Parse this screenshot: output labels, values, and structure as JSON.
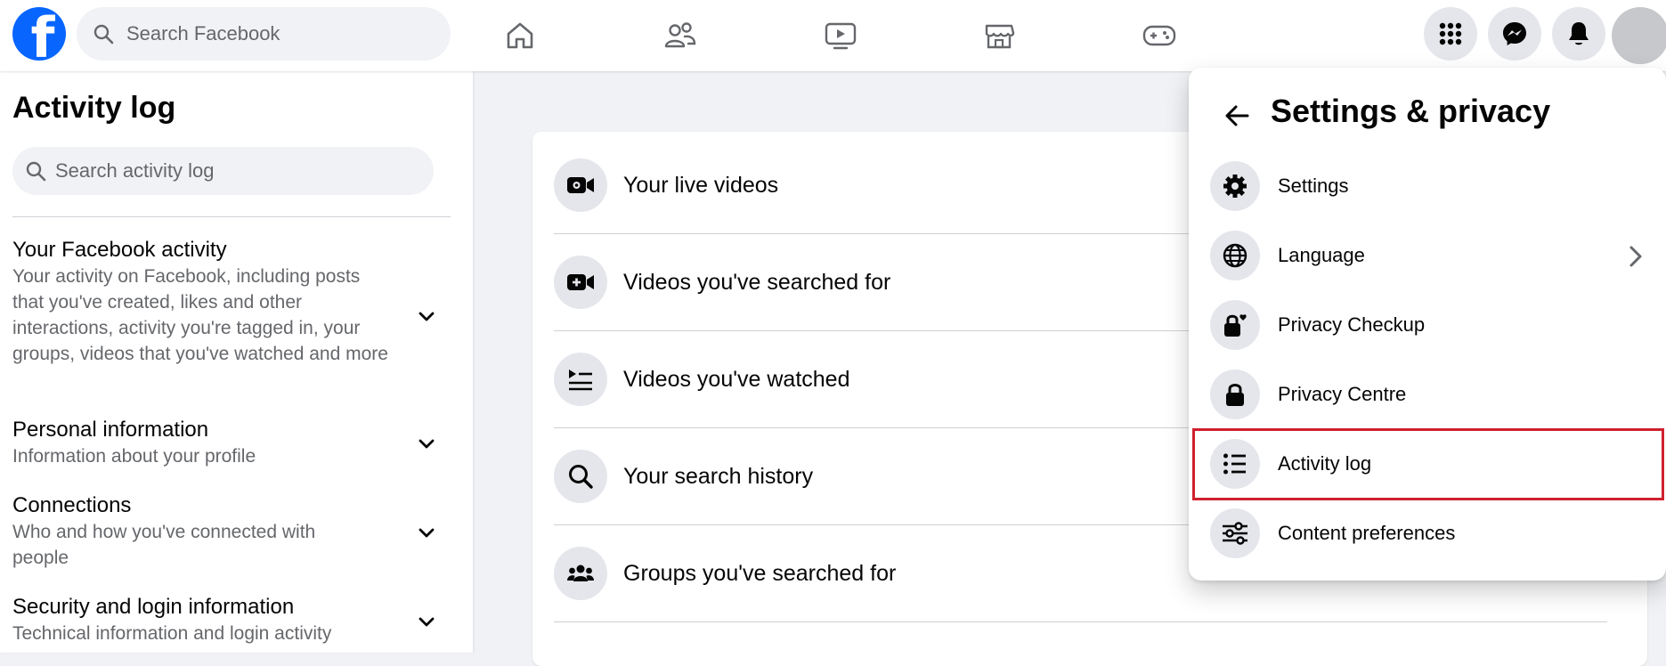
{
  "header": {
    "logo_text": "f",
    "search_placeholder": "Search Facebook",
    "nav_icons": [
      "home-icon",
      "friends-icon",
      "video-icon",
      "marketplace-icon",
      "gaming-icon"
    ],
    "right_icons": [
      "menu-grid-icon",
      "messenger-icon",
      "notifications-icon",
      "account-avatar"
    ]
  },
  "sidebar": {
    "title": "Activity log",
    "search_placeholder": "Search activity log",
    "sections": [
      {
        "title": "Your Facebook activity",
        "description": "Your activity on Facebook, including posts that you've created, likes and other interactions, activity you're tagged in, your groups, videos that you've watched and more"
      },
      {
        "title": "Personal information",
        "description": "Information about your profile"
      },
      {
        "title": "Connections",
        "description": "Who and how you've connected with people"
      },
      {
        "title": "Security and login information",
        "description": "Technical information and login activity"
      }
    ]
  },
  "main": {
    "rows": [
      {
        "label": "Your live videos",
        "icon": "live-video-icon"
      },
      {
        "label": "Videos you've searched for",
        "icon": "video-add-icon"
      },
      {
        "label": "Videos you've watched",
        "icon": "video-list-icon"
      },
      {
        "label": "Your search history",
        "icon": "search-icon"
      },
      {
        "label": "Groups you've searched for",
        "icon": "groups-icon"
      }
    ]
  },
  "dropdown": {
    "title": "Settings & privacy",
    "items": [
      {
        "label": "Settings",
        "icon": "gear-icon"
      },
      {
        "label": "Language",
        "icon": "globe-icon",
        "has_submenu": true
      },
      {
        "label": "Privacy Checkup",
        "icon": "lock-heart-icon"
      },
      {
        "label": "Privacy Centre",
        "icon": "lock-icon"
      },
      {
        "label": "Activity log",
        "icon": "list-icon",
        "highlighted": true
      },
      {
        "label": "Content preferences",
        "icon": "sliders-icon"
      }
    ]
  },
  "colors": {
    "brand": "#0866ff",
    "highlight_border": "#d0202e",
    "page_background": "#f0f2f5",
    "secondary_text": "#65676b"
  }
}
